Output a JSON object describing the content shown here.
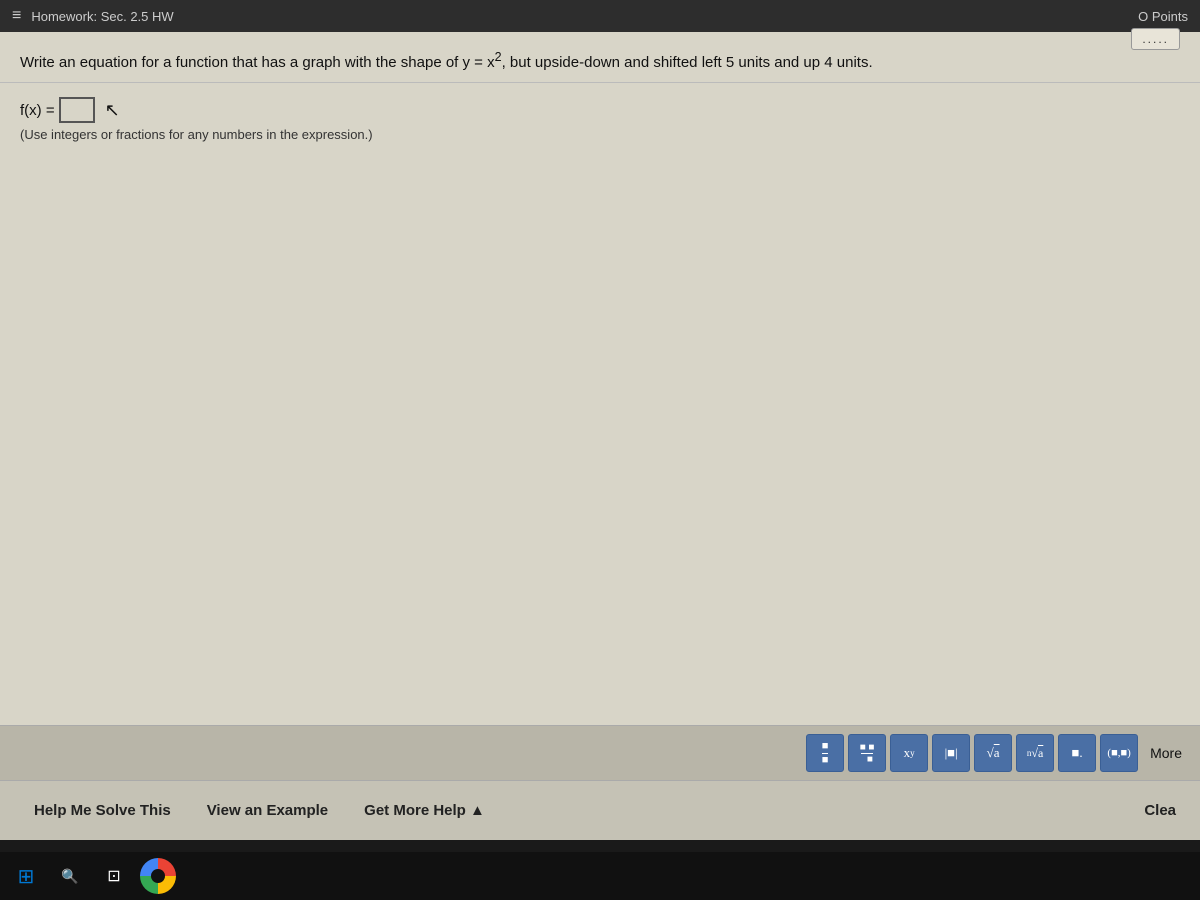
{
  "topbar": {
    "menu_icon": "≡",
    "title": "Homework: Sec. 2.5 HW",
    "points_label": "O Points"
  },
  "question": {
    "text": "Write an equation for a function that has a graph with the shape of y = x², but upside-down and shifted left 5 units and up 4 units.",
    "dots_button_label": ".....",
    "fx_label": "f(x) =",
    "hint": "(Use integers or fractions for any numbers in the expression.)"
  },
  "math_toolbar": {
    "buttons": [
      {
        "id": "fraction-btn",
        "symbol": "÷",
        "label": "fraction"
      },
      {
        "id": "mixed-btn",
        "symbol": "⁑÷",
        "label": "mixed number"
      },
      {
        "id": "exponent-btn",
        "symbol": "xʸ",
        "label": "exponent"
      },
      {
        "id": "abs-btn",
        "symbol": "|x|",
        "label": "absolute value"
      },
      {
        "id": "sqrt-btn",
        "symbol": "√a",
        "label": "square root"
      },
      {
        "id": "nthroot-btn",
        "symbol": "ⁿ√a",
        "label": "nth root"
      },
      {
        "id": "decimal-btn",
        "symbol": "■.",
        "label": "decimal"
      },
      {
        "id": "paren-btn",
        "symbol": "(•,•)",
        "label": "parentheses"
      }
    ],
    "more_label": "More"
  },
  "bottom_bar": {
    "help_me_solve_label": "Help Me Solve This",
    "view_example_label": "View an Example",
    "get_more_help_label": "Get More Help ▲",
    "clear_label": "Clea"
  },
  "taskbar": {
    "windows_icon": "⊞",
    "search_icon": "🔍",
    "task_icon": "⊡"
  }
}
